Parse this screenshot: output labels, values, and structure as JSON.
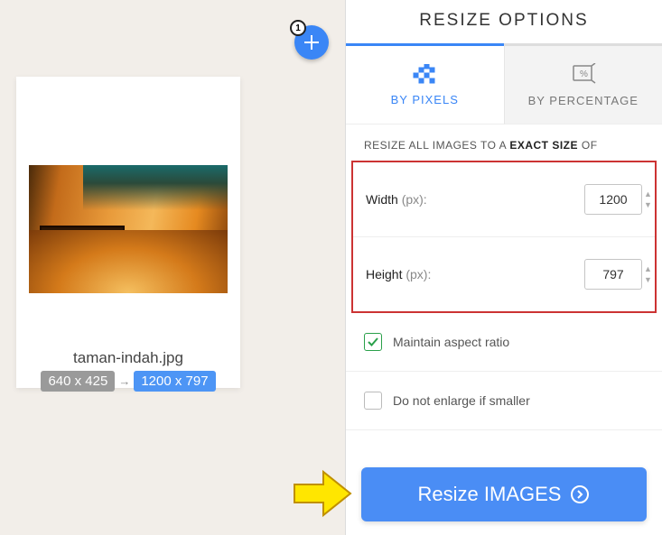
{
  "left": {
    "add_count": "1",
    "file_name": "taman-indah.jpg",
    "dim_old": "640 x 425",
    "dim_new": "1200 x 797"
  },
  "panel": {
    "title": "RESIZE OPTIONS",
    "tabs": {
      "pixels": "BY PIXELS",
      "percentage": "BY PERCENTAGE"
    },
    "desc_pre": "RESIZE ALL IMAGES TO A ",
    "desc_bold": "EXACT SIZE",
    "desc_post": " OF",
    "width_label": "Width ",
    "width_unit": "(px):",
    "width_value": "1200",
    "height_label": "Height ",
    "height_unit": "(px):",
    "height_value": "797",
    "maintain_label": "Maintain aspect ratio",
    "enlarge_label": "Do not enlarge if smaller",
    "button": "Resize IMAGES"
  }
}
